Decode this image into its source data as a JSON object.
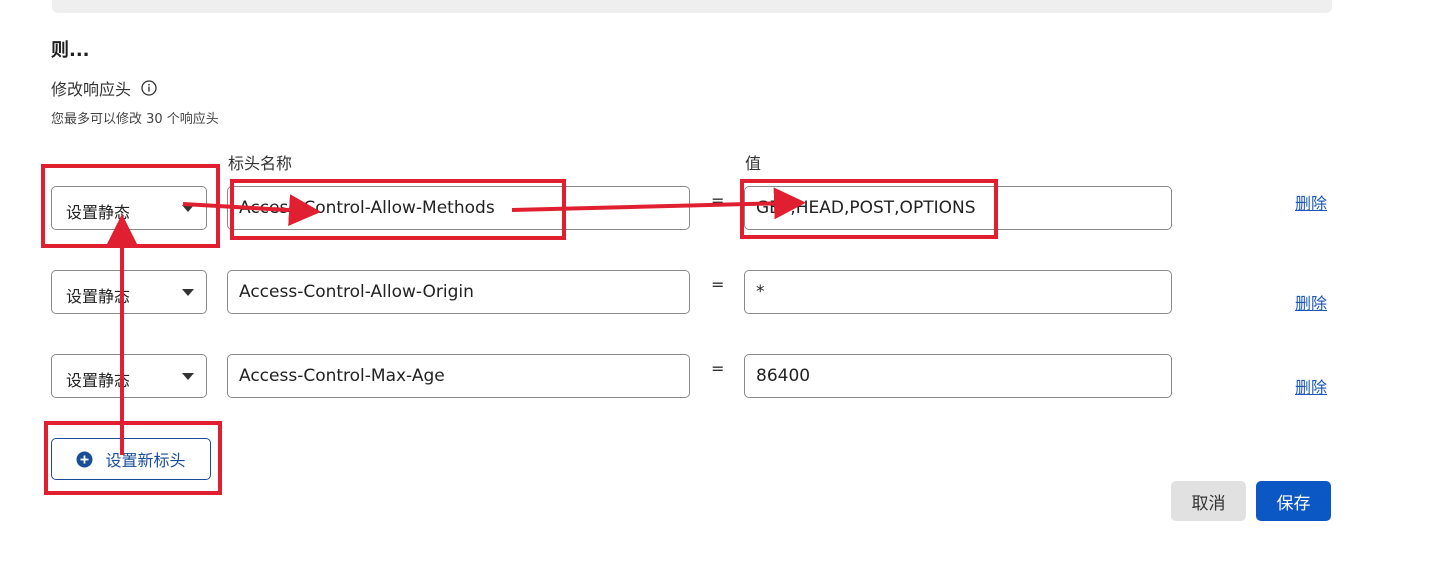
{
  "section": {
    "then_title": "则...",
    "modify_title": "修改响应头",
    "hint": "您最多可以修改 30 个响应头"
  },
  "columns": {
    "name_header": "标头名称",
    "value_header": "值"
  },
  "rows": [
    {
      "operation": "设置静态",
      "header_name": "Access-Control-Allow-Methods",
      "equals": "=",
      "value": "GET,HEAD,POST,OPTIONS",
      "delete_label": "删除"
    },
    {
      "operation": "设置静态",
      "header_name": "Access-Control-Allow-Origin",
      "equals": "=",
      "value": "*",
      "delete_label": "删除"
    },
    {
      "operation": "设置静态",
      "header_name": "Access-Control-Max-Age",
      "equals": "=",
      "value": "86400",
      "delete_label": "删除"
    }
  ],
  "actions": {
    "add_header_label": "设置新标头",
    "cancel_label": "取消",
    "save_label": "保存"
  },
  "colors": {
    "primary": "#0b57c4",
    "link": "#1a57b8",
    "annotation_red": "#e02030"
  },
  "icons": [
    "info-icon",
    "plus-circle-icon",
    "chevron-down-icon"
  ]
}
